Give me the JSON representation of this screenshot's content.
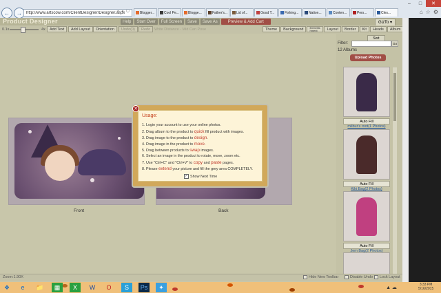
{
  "browser": {
    "url": "http://www.artscow.com/ClientDesigner/Designer.aspx",
    "tabs": [
      {
        "label": "Blogger...",
        "color": "#e46b2c"
      },
      {
        "label": "Cool Pe...",
        "color": "#3a3a3a"
      },
      {
        "label": "Blogge...",
        "color": "#e46b2c"
      },
      {
        "label": "Father's...",
        "color": "#5a3f2a"
      },
      {
        "label": "Lid of...",
        "color": "#7a5a3a"
      },
      {
        "label": "Good T...",
        "color": "#c04040"
      },
      {
        "label": "Fishing...",
        "color": "#3a6ab0"
      },
      {
        "label": "Nation...",
        "color": "#2a4a7a"
      },
      {
        "label": "Conten...",
        "color": "#5a8ac0"
      },
      {
        "label": "Pers...",
        "color": "#b02020"
      },
      {
        "label": "Cles...",
        "color": "#2a5a9a"
      }
    ]
  },
  "app": {
    "title": "Product Designer",
    "header_buttons": [
      "Help",
      "Start Over",
      "Full Screen",
      "Save",
      "Save As"
    ],
    "preview_button": "Preview & Add Cart",
    "gizmo_label": "GizTo ▾",
    "toolbar": {
      "zoom_min": "0.1x",
      "zoom_max": "4x",
      "buttons": [
        "Add Text",
        "Add Layout",
        "Orientation",
        "Undo(0)",
        "Redo"
      ],
      "hint": "Write Distance - Mid Can Pose",
      "side_tabs": [
        "Theme",
        "Background",
        "Embellis hment",
        "Layout",
        "Border",
        "Kit",
        "Heads",
        "Album"
      ]
    },
    "products": {
      "front_label": "Front",
      "back_label": "Back"
    },
    "dialog": {
      "title": "Usage:",
      "instructions": [
        [
          "1. Login your account to use your online photos.",
          "",
          ""
        ],
        [
          "2. Drag album to the product to ",
          "quick",
          " fill product with images."
        ],
        [
          "3. Drag image to the product to ",
          "design",
          "."
        ],
        [
          "4. Drag image in the product to ",
          "move",
          "."
        ],
        [
          "5. Drag between products to ",
          "swap",
          " images."
        ],
        [
          "6. Select an image in the product to rotate, move, zoom etc.",
          "",
          ""
        ],
        [
          "7. Use \"Ctrl+C\" and \"Ctrl+V\" to ",
          "copy",
          " and "
        ],
        [
          "8. Please ",
          "extend",
          " your picture and fill the grey area COMPLETELY."
        ]
      ],
      "paste_word": "paste",
      "paste_suffix": " pages.",
      "show_next_time": "Show Next Time",
      "show_next_checked": "✓"
    },
    "sidebar": {
      "sort_label": "Sort",
      "filter_label": "Filter:",
      "filter_go": "Go",
      "album_count": "12 Albums",
      "upload_label": "Upload Photos",
      "albums": [
        {
          "fill_label": "Auto Fill",
          "link": "mlibur's root(1 Photos)",
          "color": "#3a2a48"
        },
        {
          "fill_label": "Auto Fill",
          "link": "Kiki Bag(2 Photos)",
          "color": "#4a2a2a"
        },
        {
          "fill_label": "Auto Fill",
          "link": "Jem Bag(2 Photos)",
          "color": "#c04080"
        }
      ]
    },
    "status": {
      "zoom": "Zoom:1.90X",
      "checkboxes": [
        "Hide New Toolbar",
        "Disable Undo",
        "Lock Layout"
      ]
    }
  },
  "taskbar": {
    "time": "3:33 PM",
    "date": "5/16/2015"
  }
}
